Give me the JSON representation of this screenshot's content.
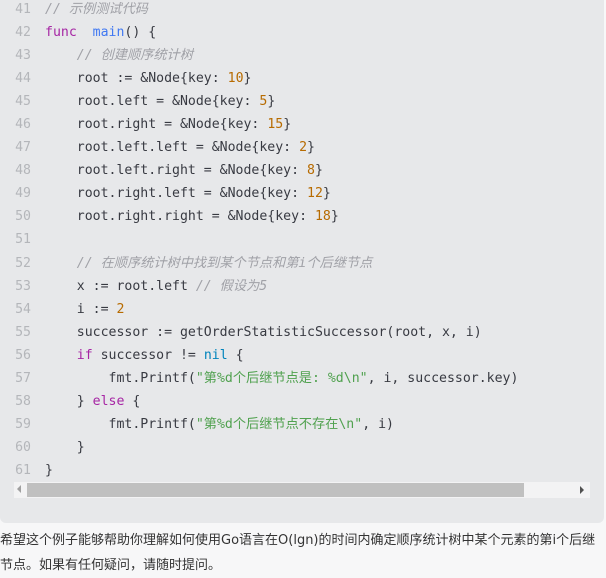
{
  "code": {
    "lines": [
      {
        "n": "41",
        "tokens": [
          [
            "com",
            "// 示例测试代码"
          ]
        ]
      },
      {
        "n": "42",
        "tokens": [
          [
            "kw",
            "func"
          ],
          [
            "",
            "  "
          ],
          [
            "fn",
            "main"
          ],
          [
            "",
            "() {"
          ]
        ]
      },
      {
        "n": "43",
        "tokens": [
          [
            "",
            "    "
          ],
          [
            "com",
            "// 创建顺序统计树"
          ]
        ]
      },
      {
        "n": "44",
        "tokens": [
          [
            "",
            "    root := &Node{key: "
          ],
          [
            "num",
            "10"
          ],
          [
            "",
            "}"
          ]
        ]
      },
      {
        "n": "45",
        "tokens": [
          [
            "",
            "    root.left = &Node{key: "
          ],
          [
            "num",
            "5"
          ],
          [
            "",
            "}"
          ]
        ]
      },
      {
        "n": "46",
        "tokens": [
          [
            "",
            "    root.right = &Node{key: "
          ],
          [
            "num",
            "15"
          ],
          [
            "",
            "}"
          ]
        ]
      },
      {
        "n": "47",
        "tokens": [
          [
            "",
            "    root.left.left = &Node{key: "
          ],
          [
            "num",
            "2"
          ],
          [
            "",
            "}"
          ]
        ]
      },
      {
        "n": "48",
        "tokens": [
          [
            "",
            "    root.left.right = &Node{key: "
          ],
          [
            "num",
            "8"
          ],
          [
            "",
            "}"
          ]
        ]
      },
      {
        "n": "49",
        "tokens": [
          [
            "",
            "    root.right.left = &Node{key: "
          ],
          [
            "num",
            "12"
          ],
          [
            "",
            "}"
          ]
        ]
      },
      {
        "n": "50",
        "tokens": [
          [
            "",
            "    root.right.right = &Node{key: "
          ],
          [
            "num",
            "18"
          ],
          [
            "",
            "}"
          ]
        ]
      },
      {
        "n": "51",
        "tokens": []
      },
      {
        "n": "52",
        "tokens": [
          [
            "",
            "    "
          ],
          [
            "com",
            "// 在顺序统计树中找到某个节点和第i个后继节点"
          ]
        ]
      },
      {
        "n": "53",
        "tokens": [
          [
            "",
            "    x := root.left "
          ],
          [
            "com",
            "// 假设为5"
          ]
        ]
      },
      {
        "n": "54",
        "tokens": [
          [
            "",
            "    i := "
          ],
          [
            "num",
            "2"
          ]
        ]
      },
      {
        "n": "55",
        "tokens": [
          [
            "",
            "    successor := getOrderStatisticSuccessor(root, x, i)"
          ]
        ]
      },
      {
        "n": "56",
        "tokens": [
          [
            "",
            "    "
          ],
          [
            "kw",
            "if"
          ],
          [
            "",
            " successor != "
          ],
          [
            "lit",
            "nil"
          ],
          [
            "",
            " {"
          ]
        ]
      },
      {
        "n": "57",
        "tokens": [
          [
            "",
            "        fmt.Printf("
          ],
          [
            "str",
            "\"第%d个后继节点是: %d\\n\""
          ],
          [
            "",
            ", i, successor.key)"
          ]
        ]
      },
      {
        "n": "58",
        "tokens": [
          [
            "",
            "    } "
          ],
          [
            "kw",
            "else"
          ],
          [
            "",
            " {"
          ]
        ]
      },
      {
        "n": "59",
        "tokens": [
          [
            "",
            "        fmt.Printf("
          ],
          [
            "str",
            "\"第%d个后继节点不存在\\n\""
          ],
          [
            "",
            ", i)"
          ]
        ]
      },
      {
        "n": "60",
        "tokens": [
          [
            "",
            "    }"
          ]
        ]
      },
      {
        "n": "61",
        "tokens": [
          [
            "",
            "}"
          ]
        ]
      }
    ]
  },
  "scrollbar": {
    "position_percent": 0,
    "visible_fraction": 0.88
  },
  "paragraph": "希望这个例子能够帮助你理解如何使用Go语言在O(lgn)的时间内确定顺序统计树中某个元素的第i个后继节点。如果有任何疑问，请随时提问。"
}
